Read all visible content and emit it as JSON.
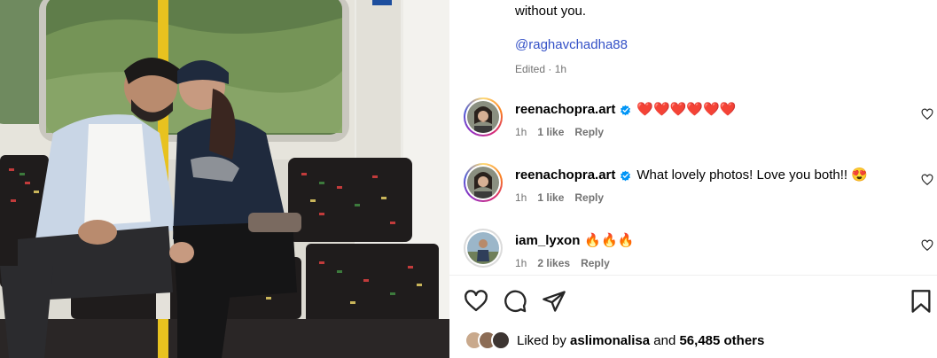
{
  "post": {
    "caption_tail": "without you.",
    "mention": "@raghavchadha88",
    "caption_meta": "Edited · 1h"
  },
  "comments": [
    {
      "username": "reenachopra.art",
      "verified": true,
      "text": "❤️❤️❤️❤️❤️❤️",
      "time": "1h",
      "likes": "1 like",
      "reply": "Reply"
    },
    {
      "username": "reenachopra.art",
      "verified": true,
      "text": "What lovely photos! Love you both!! 😍",
      "time": "1h",
      "likes": "1 like",
      "reply": "Reply"
    },
    {
      "username": "iam_lyxon",
      "verified": false,
      "text": "🔥🔥🔥",
      "time": "1h",
      "likes": "2 likes",
      "reply": "Reply"
    }
  ],
  "actions": {
    "icons": [
      "heart-icon",
      "comment-icon",
      "share-icon",
      "bookmark-icon"
    ]
  },
  "likes": {
    "prefix": "Liked by",
    "user": "aslimonalisa",
    "middle": "and",
    "count": "56,485 others"
  },
  "colors": {
    "link": "#3451c7",
    "meta": "#737373",
    "verified": "#0095f6"
  }
}
